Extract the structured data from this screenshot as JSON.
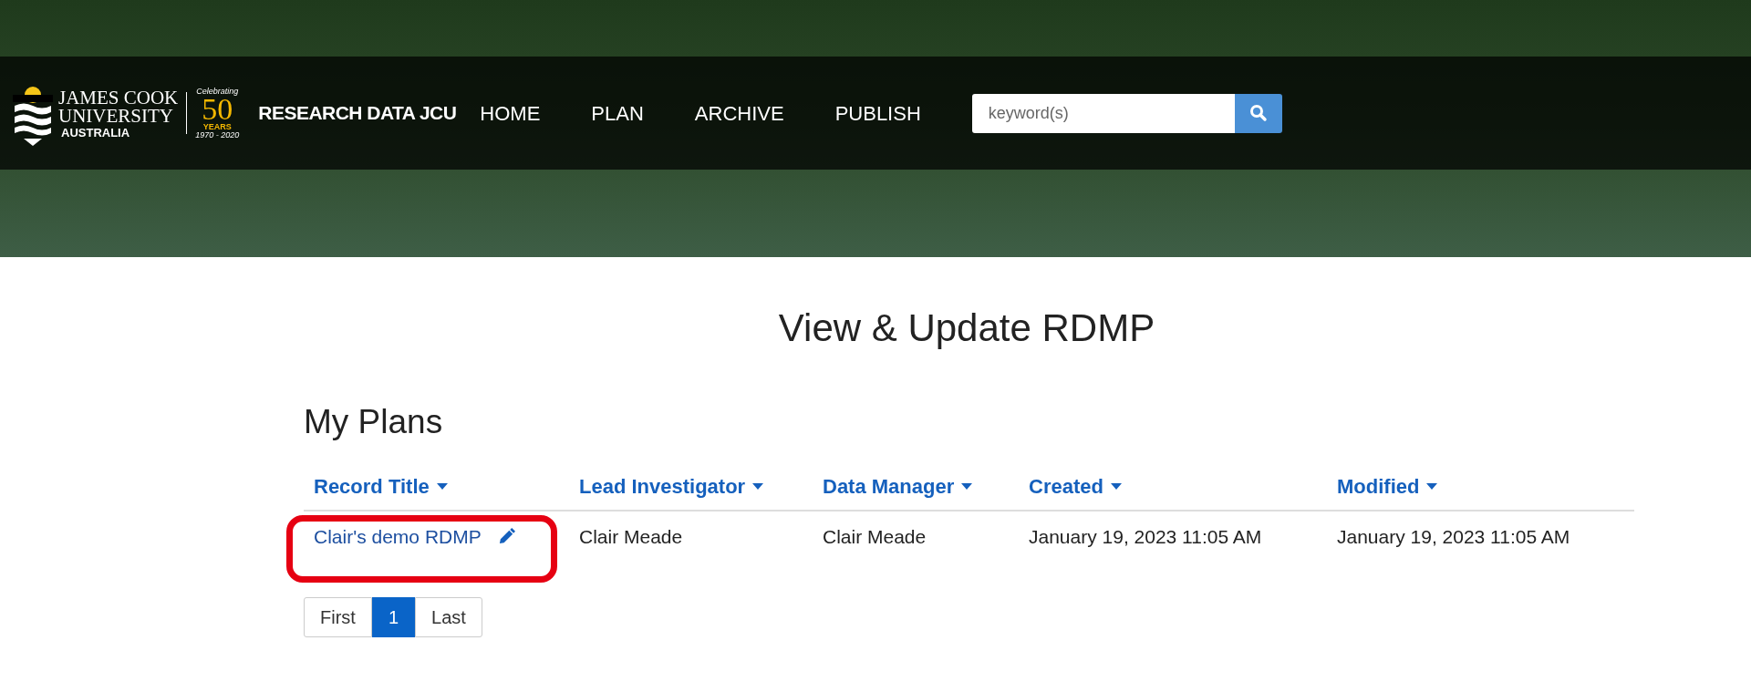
{
  "header": {
    "logo": {
      "line_1": "JAMES COOK",
      "line_2": "UNIVERSITY",
      "line_3": "AUSTRALIA",
      "anniversary_top": "Celebrating",
      "anniversary_number": "50",
      "anniversary_years": "YEARS",
      "anniversary_dates": "1970 - 2020"
    },
    "site_title": "RESEARCH DATA JCU",
    "nav": [
      {
        "label": "HOME"
      },
      {
        "label": "PLAN"
      },
      {
        "label": "ARCHIVE"
      },
      {
        "label": "PUBLISH"
      }
    ],
    "search": {
      "placeholder": "keyword(s)"
    }
  },
  "page_title": "View & Update RDMP",
  "section_title": "My Plans",
  "table": {
    "columns": [
      {
        "label": "Record Title"
      },
      {
        "label": "Lead Investigator"
      },
      {
        "label": "Data Manager"
      },
      {
        "label": "Created"
      },
      {
        "label": "Modified"
      }
    ],
    "rows": [
      {
        "record_title": "Clair's demo RDMP",
        "highlighted": true,
        "lead_investigator": "Clair Meade",
        "data_manager": "Clair Meade",
        "created": "January 19, 2023 11:05 AM",
        "modified": "January 19, 2023 11:05 AM"
      }
    ]
  },
  "pagination": [
    {
      "label": "First",
      "selected": false
    },
    {
      "label": "1",
      "selected": true
    },
    {
      "label": "Last",
      "selected": false
    }
  ]
}
